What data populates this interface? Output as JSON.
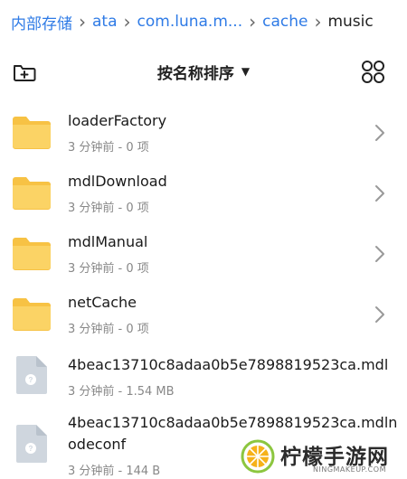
{
  "breadcrumb": {
    "items": [
      "内部存储",
      "ata",
      "com.luna.m...",
      "cache",
      "music"
    ]
  },
  "toolbar": {
    "sort_label": "按名称排序",
    "sort_caret": "▼"
  },
  "files": [
    {
      "name": "loaderFactory",
      "meta": "3 分钟前 - 0 项",
      "type": "folder"
    },
    {
      "name": "mdlDownload",
      "meta": "3 分钟前 - 0 项",
      "type": "folder"
    },
    {
      "name": "mdlManual",
      "meta": "3 分钟前 - 0 项",
      "type": "folder"
    },
    {
      "name": "netCache",
      "meta": "3 分钟前 - 0 项",
      "type": "folder"
    },
    {
      "name": "4beac13710c8adaa0b5e7898819523ca.mdl",
      "meta": "3 分钟前 - 1.54 MB",
      "type": "file"
    },
    {
      "name_line1": "4beac13710c8adaa0b5e7898819523ca.mdln",
      "name_line2": "odeconf",
      "meta": "3 分钟前 - 144 B",
      "type": "file"
    }
  ],
  "watermark": {
    "text": "柠檬手游网",
    "sub": "NINGMAKEUP.COM"
  },
  "colors": {
    "accent": "#2f7be6",
    "folder": "#f7c244",
    "file_icon": "#cfd6de"
  }
}
